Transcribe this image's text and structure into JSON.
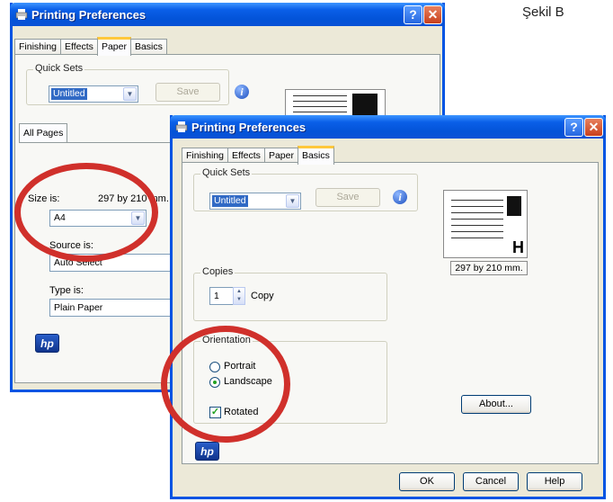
{
  "caption": "Şekil B",
  "back_window": {
    "title": "Printing Preferences",
    "tabs": [
      "Finishing",
      "Effects",
      "Paper",
      "Basics"
    ],
    "active_tab": "Paper",
    "quick_sets_label": "Quick Sets",
    "quick_sets_value": "Untitled",
    "save_label": "Save",
    "inner_tab": "All Pages",
    "size_label": "Size is:",
    "size_dims": "297 by 210 mm.",
    "size_value": "A4",
    "source_label": "Source is:",
    "source_value": "Auto Select",
    "type_label": "Type is:",
    "type_value": "Plain Paper",
    "logo": "hp"
  },
  "front_window": {
    "title": "Printing Preferences",
    "tabs": [
      "Finishing",
      "Effects",
      "Paper",
      "Basics"
    ],
    "active_tab": "Basics",
    "quick_sets_label": "Quick Sets",
    "quick_sets_value": "Untitled",
    "save_label": "Save",
    "preview_caption": "297 by 210 mm.",
    "copies_label": "Copies",
    "copies_value": "1",
    "copies_unit": "Copy",
    "orientation_label": "Orientation",
    "portrait_label": "Portrait",
    "landscape_label": "Landscape",
    "rotated_label": "Rotated",
    "orientation_selected": "Landscape",
    "rotated_checked": true,
    "about_label": "About...",
    "ok_label": "OK",
    "cancel_label": "Cancel",
    "help_label": "Help",
    "logo": "hp",
    "preview_letter": "H"
  },
  "annotation_color": "#d0302b"
}
